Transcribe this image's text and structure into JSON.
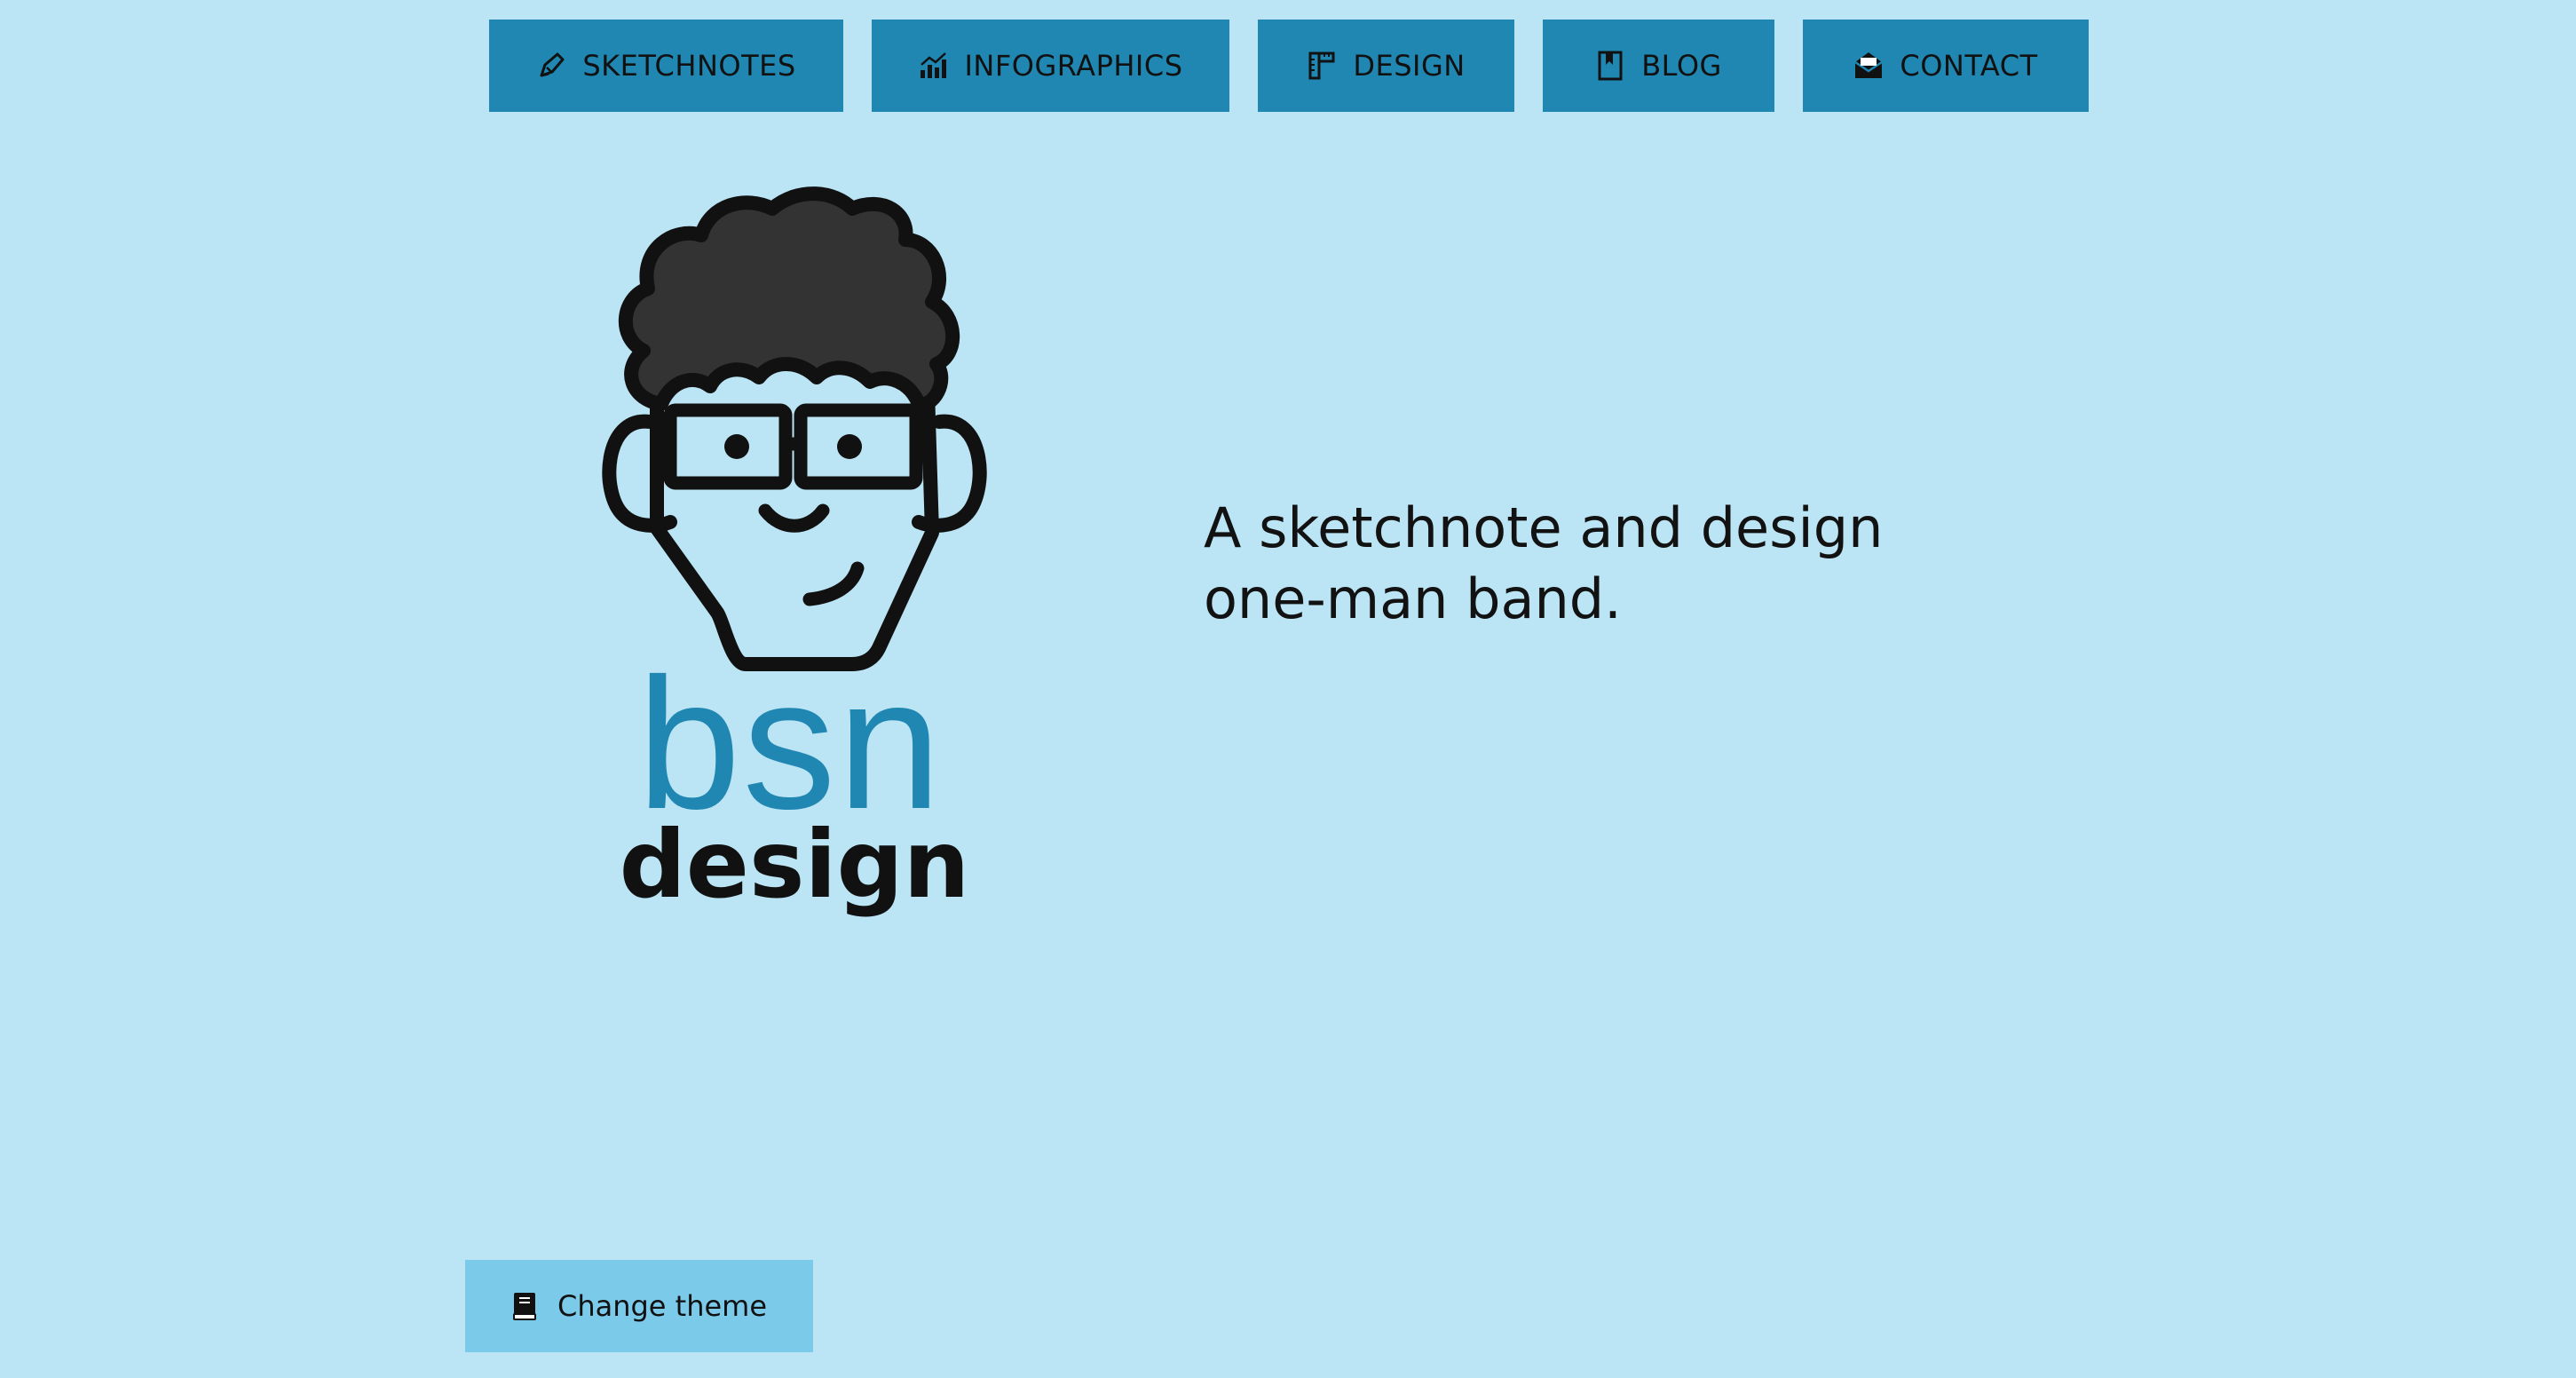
{
  "nav": {
    "items": [
      {
        "label": "SKETCHNOTES",
        "icon": "pen-icon"
      },
      {
        "label": "INFOGRAPHICS",
        "icon": "chart-icon"
      },
      {
        "label": "DESIGN",
        "icon": "ruler-icon"
      },
      {
        "label": "BLOG",
        "icon": "bookmark-icon"
      },
      {
        "label": "CONTACT",
        "icon": "envelope-icon"
      }
    ]
  },
  "logo": {
    "line1": "bsn",
    "line2": "design"
  },
  "main": {
    "tagline": "A sketchnote and design one-man band."
  },
  "theme_button": {
    "label": "Change theme",
    "icon": "book-icon"
  },
  "colors": {
    "background": "#bbe4f4",
    "nav_button": "#2087b2",
    "theme_button": "#7ccaea",
    "logo_accent": "#2087b2",
    "hair": "#333333"
  }
}
